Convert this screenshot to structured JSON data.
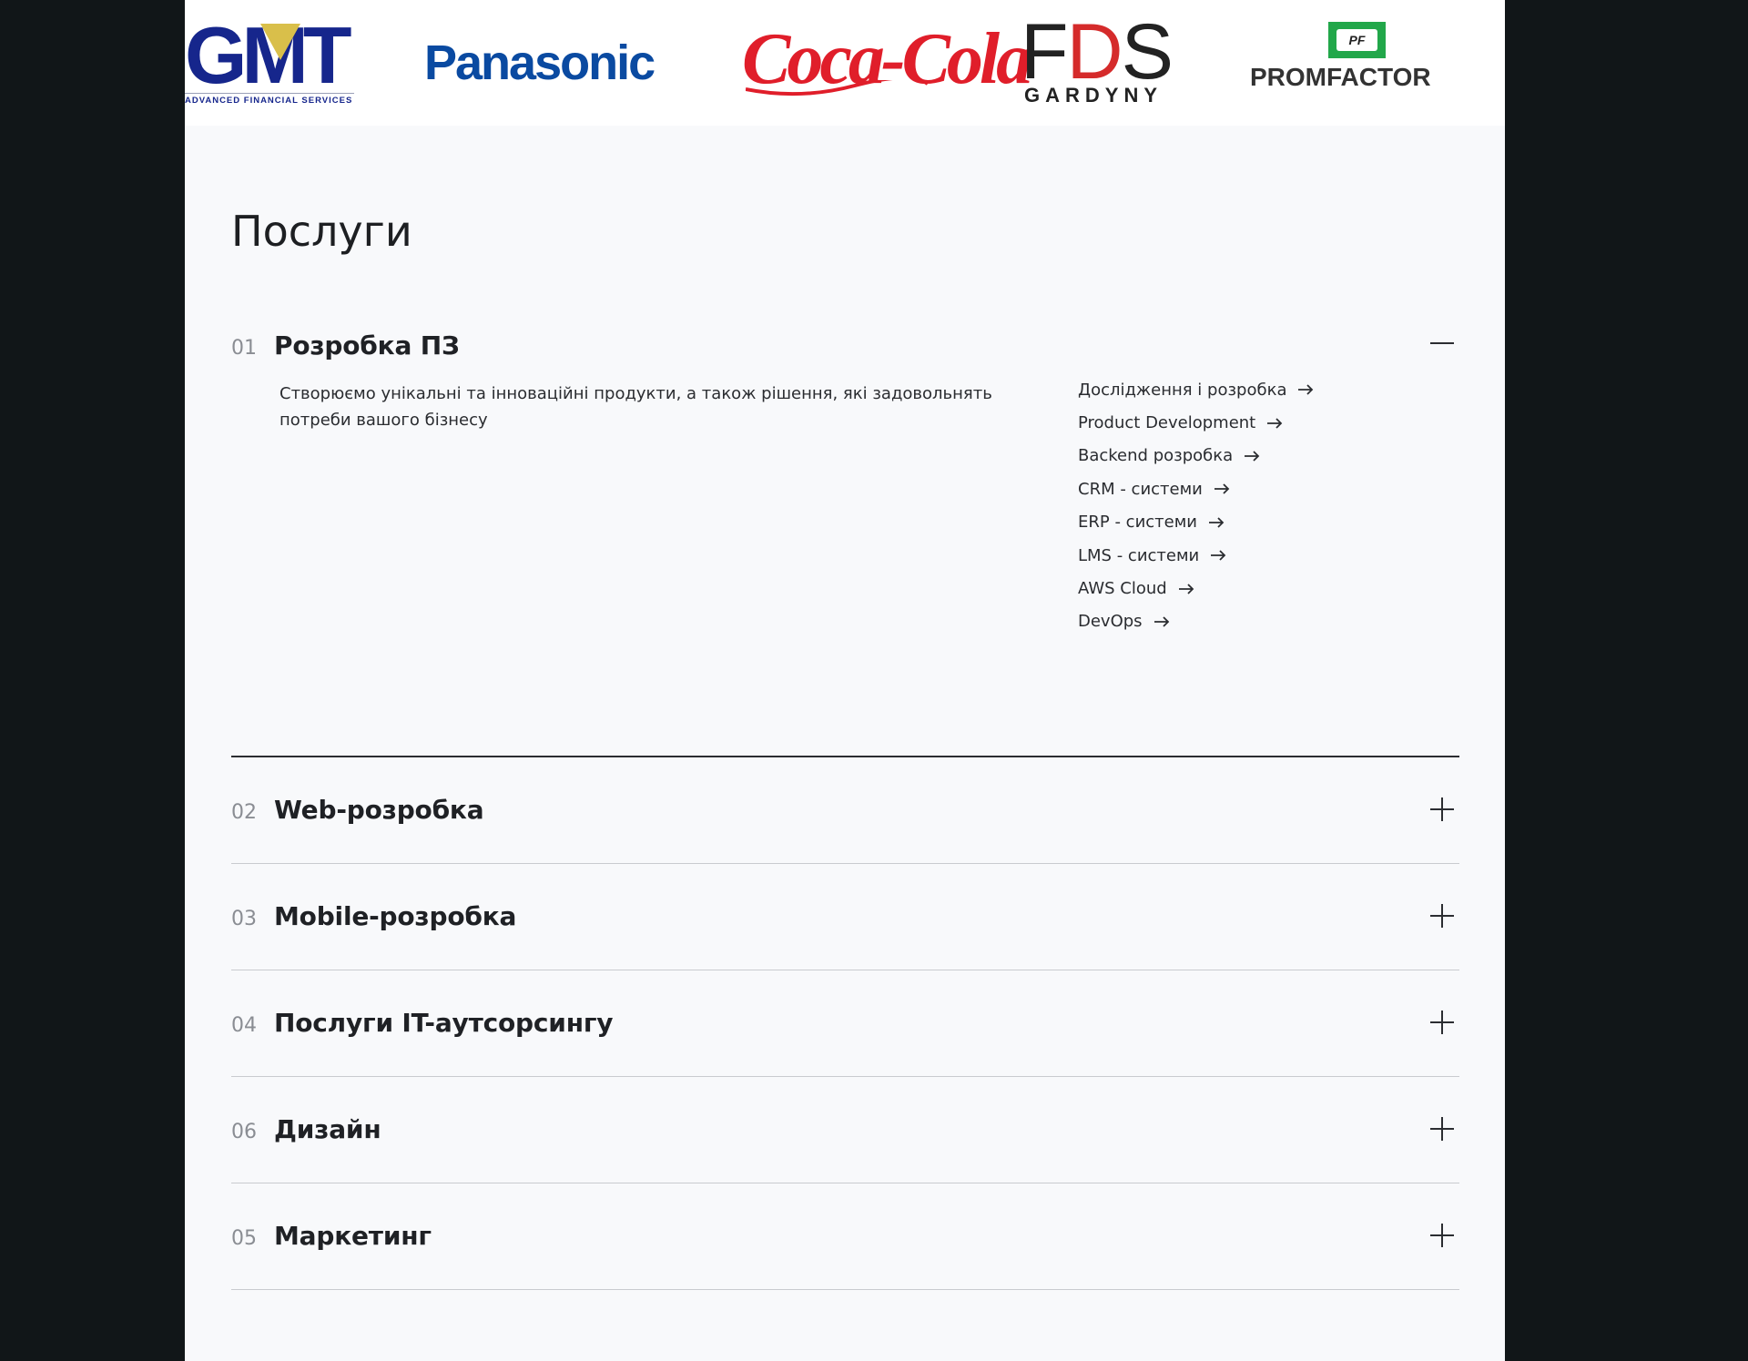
{
  "logos": {
    "gmt": {
      "mark": "GMT",
      "tagline": "ADVANCED FINANCIAL SERVICES"
    },
    "panasonic": {
      "mark": "Panasonic"
    },
    "cocacola": {
      "mark": "Coca-Cola"
    },
    "fds": {
      "mark_left": "F",
      "mark_d": "D",
      "mark_right": "S",
      "tagline": "GARDYNY"
    },
    "promfactor": {
      "badge": "PF",
      "mark": "PROMFACTOR"
    }
  },
  "services": {
    "title": "Послуги",
    "items": [
      {
        "num": "01",
        "title": "Розробка ПЗ",
        "open": true,
        "description": "Створюємо унікальні та інноваційні продукти, а також рішення, які задовольнять потреби вашого бізнесу",
        "links": [
          "Дослідження і розробка",
          "Product Development",
          "Backend розробка",
          "CRM - системи",
          "ERP - системи",
          "LMS - системи",
          "AWS Cloud",
          "DevOps"
        ]
      },
      {
        "num": "02",
        "title": "Web-розробка",
        "open": false
      },
      {
        "num": "03",
        "title": "Mobile-розробка",
        "open": false
      },
      {
        "num": "04",
        "title": "Послуги IT-аутсорсингу",
        "open": false
      },
      {
        "num": "06",
        "title": "Дизайн",
        "open": false
      },
      {
        "num": "05",
        "title": "Маркетинг",
        "open": false
      }
    ]
  },
  "icons": {
    "collapse": "minus-icon",
    "expand": "plus-icon",
    "link": "arrow-right-icon"
  },
  "colors": {
    "background": "#111618",
    "page": "#f8f9fb",
    "text": "#1d1f22",
    "muted": "#8a8d93",
    "gmt_blue": "#16268c",
    "panasonic_blue": "#0a4aa1",
    "coca_red": "#e01e2a",
    "fds_red": "#d52b2b",
    "pf_green": "#22a74a"
  }
}
